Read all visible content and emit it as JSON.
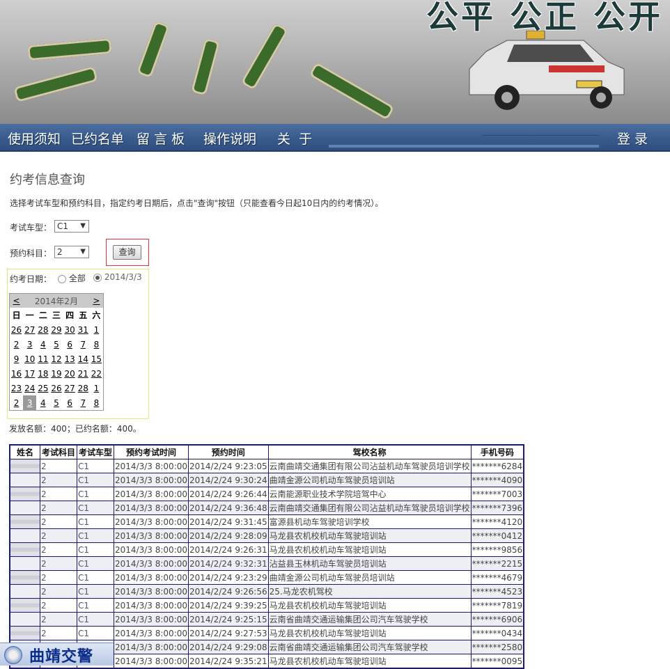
{
  "banner": {
    "slogan": "公平 公正 公开"
  },
  "nav": {
    "items": [
      "使用须知",
      "已约名单",
      "留 言 板",
      "操作说明",
      "关  于"
    ],
    "login": "登 录"
  },
  "page": {
    "title": "约考信息查询",
    "description": "选择考试车型和预约科目，指定约考日期后，点击\"查询\"按钮（只能查看今日起10日内的约考情况）。"
  },
  "form": {
    "vehicle_label": "考试车型：",
    "vehicle_value": "C1",
    "subject_label": "预约科目：",
    "subject_value": "2",
    "query_button": "查询",
    "date_label": "约考日期：",
    "radio_all": "全部",
    "radio_date": "2014/3/3"
  },
  "calendar": {
    "prev": "<",
    "next": ">",
    "month_title": "2014年2月",
    "weekdays": [
      "日",
      "一",
      "二",
      "三",
      "四",
      "五",
      "六"
    ],
    "weeks": [
      [
        "26",
        "27",
        "28",
        "29",
        "30",
        "31",
        "1"
      ],
      [
        "2",
        "3",
        "4",
        "5",
        "6",
        "7",
        "8"
      ],
      [
        "9",
        "10",
        "11",
        "12",
        "13",
        "14",
        "15"
      ],
      [
        "16",
        "17",
        "18",
        "19",
        "20",
        "21",
        "22"
      ],
      [
        "23",
        "24",
        "25",
        "26",
        "27",
        "28",
        "1"
      ],
      [
        "2",
        "3",
        "4",
        "5",
        "6",
        "7",
        "8"
      ]
    ],
    "selected": "3"
  },
  "quota": "发放名额：400；已约名额：400。",
  "table": {
    "headers": [
      "姓名",
      "考试科目",
      "考试车型",
      "预约考试时间",
      "预约时间",
      "驾校名称",
      "手机号码"
    ],
    "rows": [
      [
        "",
        "2",
        "C1",
        "2014/3/3 8:00:00",
        "2014/2/24 9:23:05",
        "云南曲靖交通集团有限公司沾益机动车驾驶员培训学校",
        "*******6284"
      ],
      [
        "",
        "2",
        "C1",
        "2014/3/3 8:00:00",
        "2014/2/24 9:30:24",
        "曲靖金源公司机动车驾驶员培训站",
        "*******4090"
      ],
      [
        "",
        "2",
        "C1",
        "2014/3/3 8:00:00",
        "2014/2/24 9:26:44",
        "云南能源职业技术学院培驾中心",
        "*******7003"
      ],
      [
        "",
        "2",
        "C1",
        "2014/3/3 8:00:00",
        "2014/2/24 9:36:48",
        "云南曲靖交通集团有限公司沾益机动车驾驶员培训学校",
        "*******7396"
      ],
      [
        "",
        "2",
        "C1",
        "2014/3/3 8:00:00",
        "2014/2/24 9:31:45",
        "富源县机动车驾驶培训学校",
        "*******4120"
      ],
      [
        "",
        "2",
        "C1",
        "2014/3/3 8:00:00",
        "2014/2/24 9:28:09",
        "马龙县农机校机动车驾驶培训站",
        "*******0412"
      ],
      [
        "",
        "2",
        "C1",
        "2014/3/3 8:00:00",
        "2014/2/24 9:26:31",
        "马龙县农机校机动车驾驶培训站",
        "*******9856"
      ],
      [
        "",
        "2",
        "C1",
        "2014/3/3 8:00:00",
        "2014/2/24 9:32:31",
        "沾益县玉林机动车驾驶员培训站",
        "*******2215"
      ],
      [
        "",
        "2",
        "C1",
        "2014/3/3 8:00:00",
        "2014/2/24 9:23:29",
        "曲靖金源公司机动车驾驶员培训站",
        "*******4679"
      ],
      [
        "",
        "2",
        "C1",
        "2014/3/3 8:00:00",
        "2014/2/24 9:26:56",
        "25.马龙农机驾校",
        "*******4523"
      ],
      [
        "",
        "2",
        "C1",
        "2014/3/3 8:00:00",
        "2014/2/24 9:39:25",
        "马龙县农机校机动车驾驶培训站",
        "*******7819"
      ],
      [
        "",
        "2",
        "C1",
        "2014/3/3 8:00:00",
        "2014/2/24 9:25:15",
        "云南省曲靖交通运输集团公司汽车驾驶学校",
        "*******6906"
      ],
      [
        "",
        "2",
        "C1",
        "2014/3/3 8:00:00",
        "2014/2/24 9:27:53",
        "马龙县农机校机动车驾驶培训站",
        "*******0434"
      ],
      [
        "",
        "2",
        "C1",
        "2014/3/3 8:00:00",
        "2014/2/24 9:29:08",
        "云南省曲靖交通运输集团公司汽车驾驶学校",
        "*******2580"
      ],
      [
        "",
        "2",
        "C1",
        "2014/3/3 8:00:00",
        "2014/2/24 9:35:21",
        "马龙县农机校机动车驾驶培训站",
        "*******0095"
      ]
    ]
  },
  "badge": {
    "text": "曲靖交警"
  }
}
